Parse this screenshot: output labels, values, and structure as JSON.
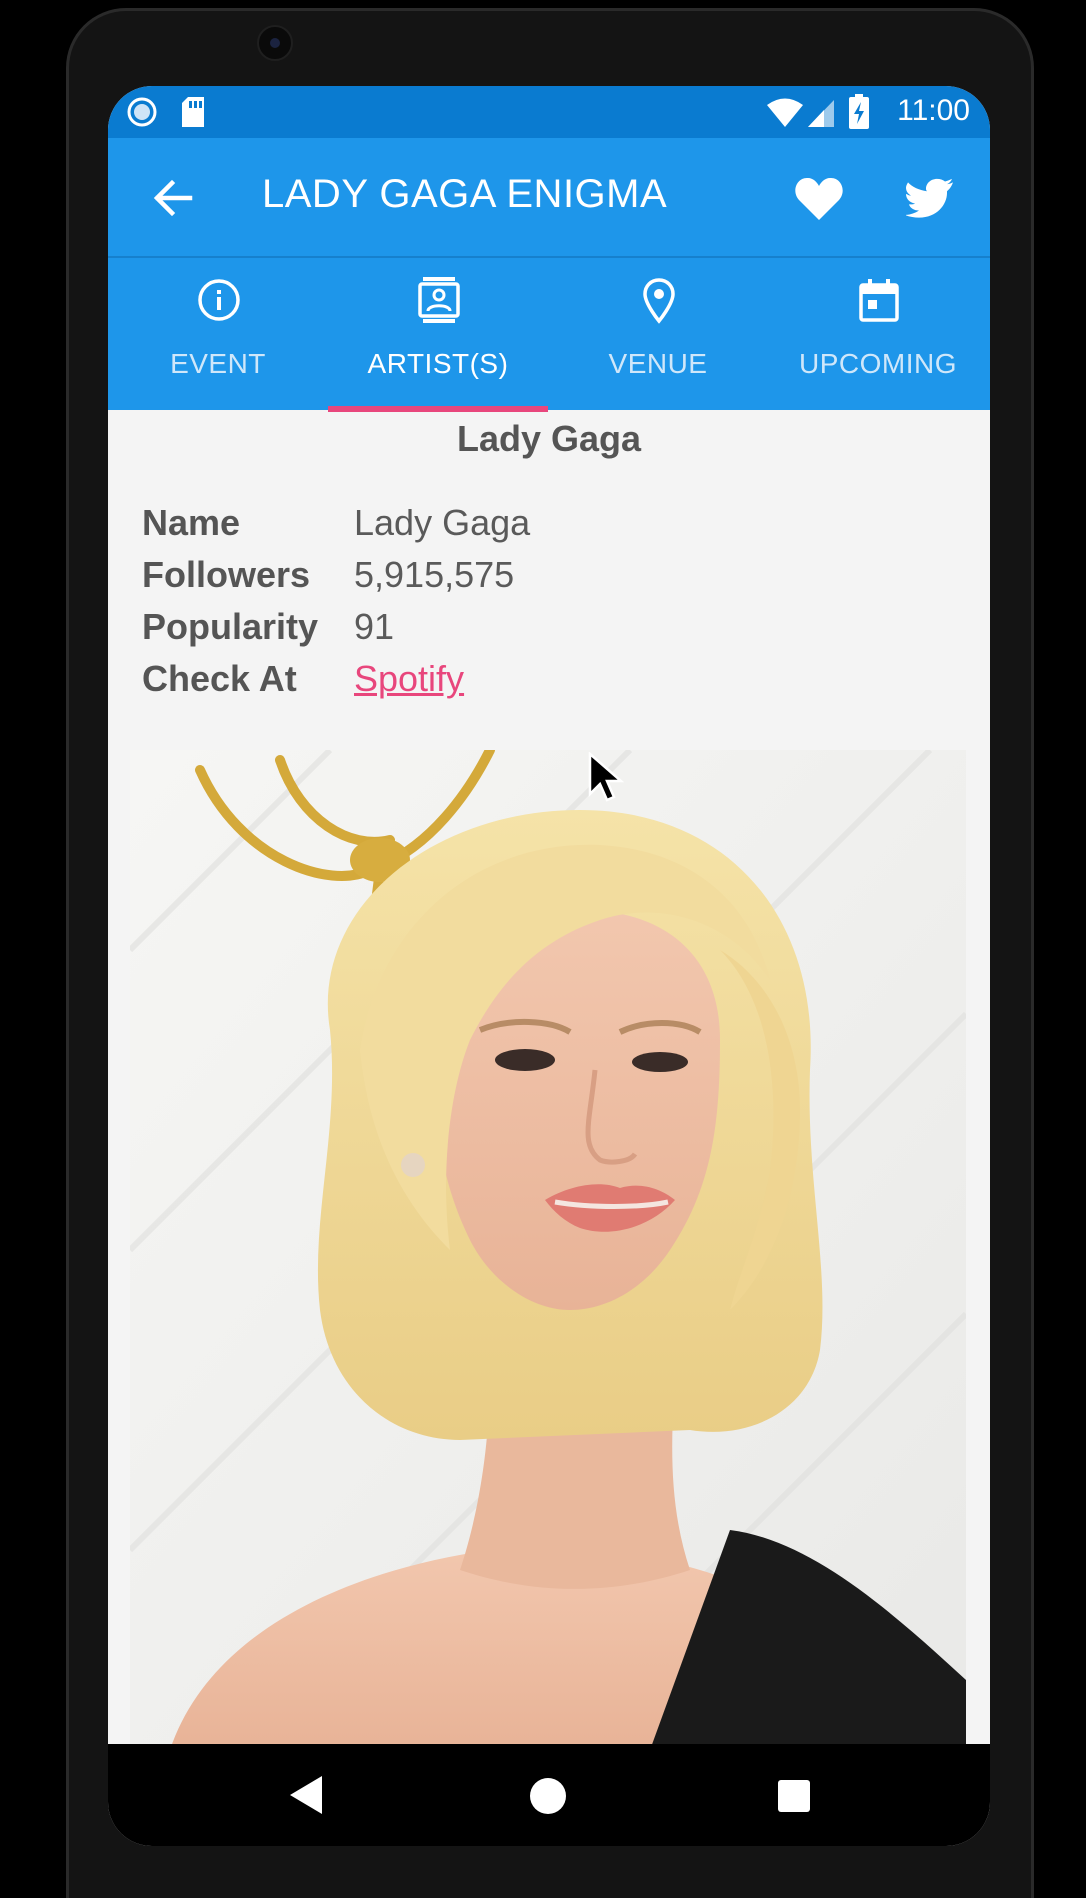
{
  "status_bar": {
    "time": "11:00",
    "icons": [
      "circle-notification-icon",
      "sd-card-icon",
      "wifi-icon",
      "signal-icon",
      "battery-charging-icon"
    ]
  },
  "toolbar": {
    "title": "LADY GAGA ENIGMA",
    "back_icon": "arrow-left-icon",
    "favorite_icon": "heart-icon",
    "share_icon": "twitter-icon"
  },
  "tabs": [
    {
      "label": "EVENT",
      "icon": "info-circle-icon",
      "active": false
    },
    {
      "label": "ARTIST(S)",
      "icon": "contact-card-icon",
      "active": true
    },
    {
      "label": "VENUE",
      "icon": "map-pin-icon",
      "active": false
    },
    {
      "label": "UPCOMING",
      "icon": "calendar-icon",
      "active": false
    }
  ],
  "artist": {
    "heading": "Lady Gaga",
    "rows": [
      {
        "label": "Name",
        "value": "Lady Gaga"
      },
      {
        "label": "Followers",
        "value": "5,915,575"
      },
      {
        "label": "Popularity",
        "value": "91"
      },
      {
        "label": "Check At",
        "value": "Spotify"
      }
    ]
  },
  "colors": {
    "status_bar": "#0a7bd0",
    "app_bar": "#1e96ea",
    "accent": "#e8467c",
    "background": "#f4f4f4"
  },
  "nav_bar": {
    "icons": [
      "nav-back-icon",
      "nav-home-icon",
      "nav-recents-icon"
    ]
  }
}
